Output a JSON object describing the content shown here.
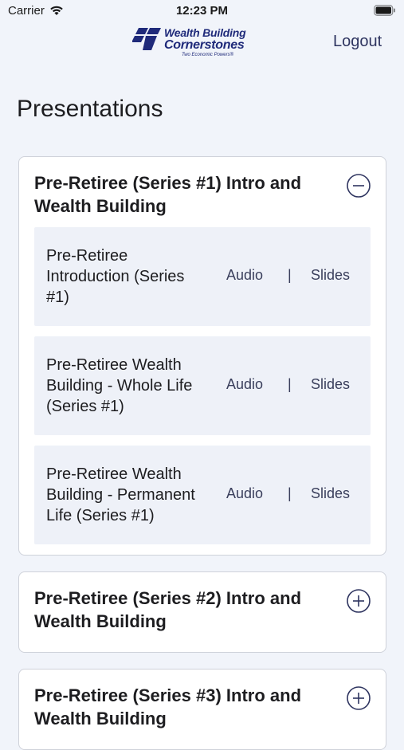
{
  "status_bar": {
    "carrier": "Carrier",
    "time": "12:23 PM"
  },
  "header": {
    "logo_line1": "Wealth Building",
    "logo_line2": "Cornerstones",
    "logo_tagline": "Two Economic Powers®",
    "logout_label": "Logout"
  },
  "page_title": "Presentations",
  "colors": {
    "accent": "#2f3560",
    "logo_navy": "#1f2a7a",
    "card_border": "#cfd2da",
    "item_bg": "#eef1f8",
    "page_bg": "#f1f4fa"
  },
  "series": [
    {
      "title": "Pre-Retiree (Series #1) Intro and Wealth Building",
      "toggle_icon": "minus-circle-icon",
      "expanded": true,
      "items": [
        {
          "title": "Pre-Retiree Introduction (Series #1)",
          "audio": "Audio",
          "separator": "|",
          "slides": "Slides"
        },
        {
          "title": "Pre-Retiree Wealth Building - Whole Life (Series #1)",
          "audio": "Audio",
          "separator": "|",
          "slides": "Slides"
        },
        {
          "title": "Pre-Retiree Wealth Building - Permanent Life (Series #1)",
          "audio": "Audio",
          "separator": "|",
          "slides": "Slides"
        }
      ]
    },
    {
      "title": "Pre-Retiree (Series #2) Intro and Wealth Building",
      "toggle_icon": "plus-circle-icon",
      "expanded": false
    },
    {
      "title": "Pre-Retiree (Series #3) Intro and Wealth Building",
      "toggle_icon": "plus-circle-icon",
      "expanded": false
    }
  ]
}
